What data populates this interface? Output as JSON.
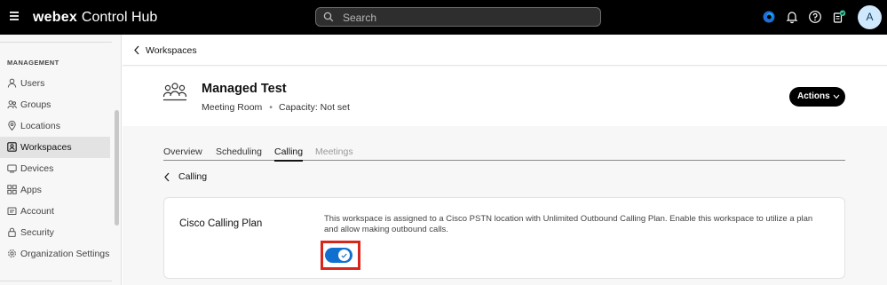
{
  "app": {
    "brand_bold": "webex",
    "brand_rest": "Control Hub"
  },
  "search": {
    "placeholder": "Search"
  },
  "user": {
    "avatar_initial": "A"
  },
  "sidebar": {
    "section_title": "MANAGEMENT",
    "items": [
      {
        "label": "Users",
        "icon": "user-icon"
      },
      {
        "label": "Groups",
        "icon": "groups-icon"
      },
      {
        "label": "Locations",
        "icon": "location-pin-icon"
      },
      {
        "label": "Workspaces",
        "icon": "workspaces-icon",
        "active": true
      },
      {
        "label": "Devices",
        "icon": "devices-icon"
      },
      {
        "label": "Apps",
        "icon": "apps-icon"
      },
      {
        "label": "Account",
        "icon": "account-icon"
      },
      {
        "label": "Security",
        "icon": "lock-icon"
      },
      {
        "label": "Organization Settings",
        "icon": "gear-icon"
      }
    ]
  },
  "breadcrumb": {
    "label": "Workspaces"
  },
  "workspace": {
    "name": "Managed Test",
    "type": "Meeting Room",
    "capacity": "Capacity: Not set",
    "actions_label": "Actions"
  },
  "tabs": [
    {
      "label": "Overview"
    },
    {
      "label": "Scheduling"
    },
    {
      "label": "Calling",
      "active": true
    },
    {
      "label": "Meetings",
      "disabled": true
    }
  ],
  "subpage": {
    "back_label": "Calling"
  },
  "calling_plan": {
    "label": "Cisco Calling Plan",
    "description": "This workspace is assigned to a Cisco PSTN location with Unlimited Outbound Calling Plan. Enable this workspace to utilize a plan and allow making outbound calls.",
    "enabled": true
  },
  "colors": {
    "accent": "#1170cf",
    "highlight": "#d9261c",
    "topbar": "#000000"
  }
}
